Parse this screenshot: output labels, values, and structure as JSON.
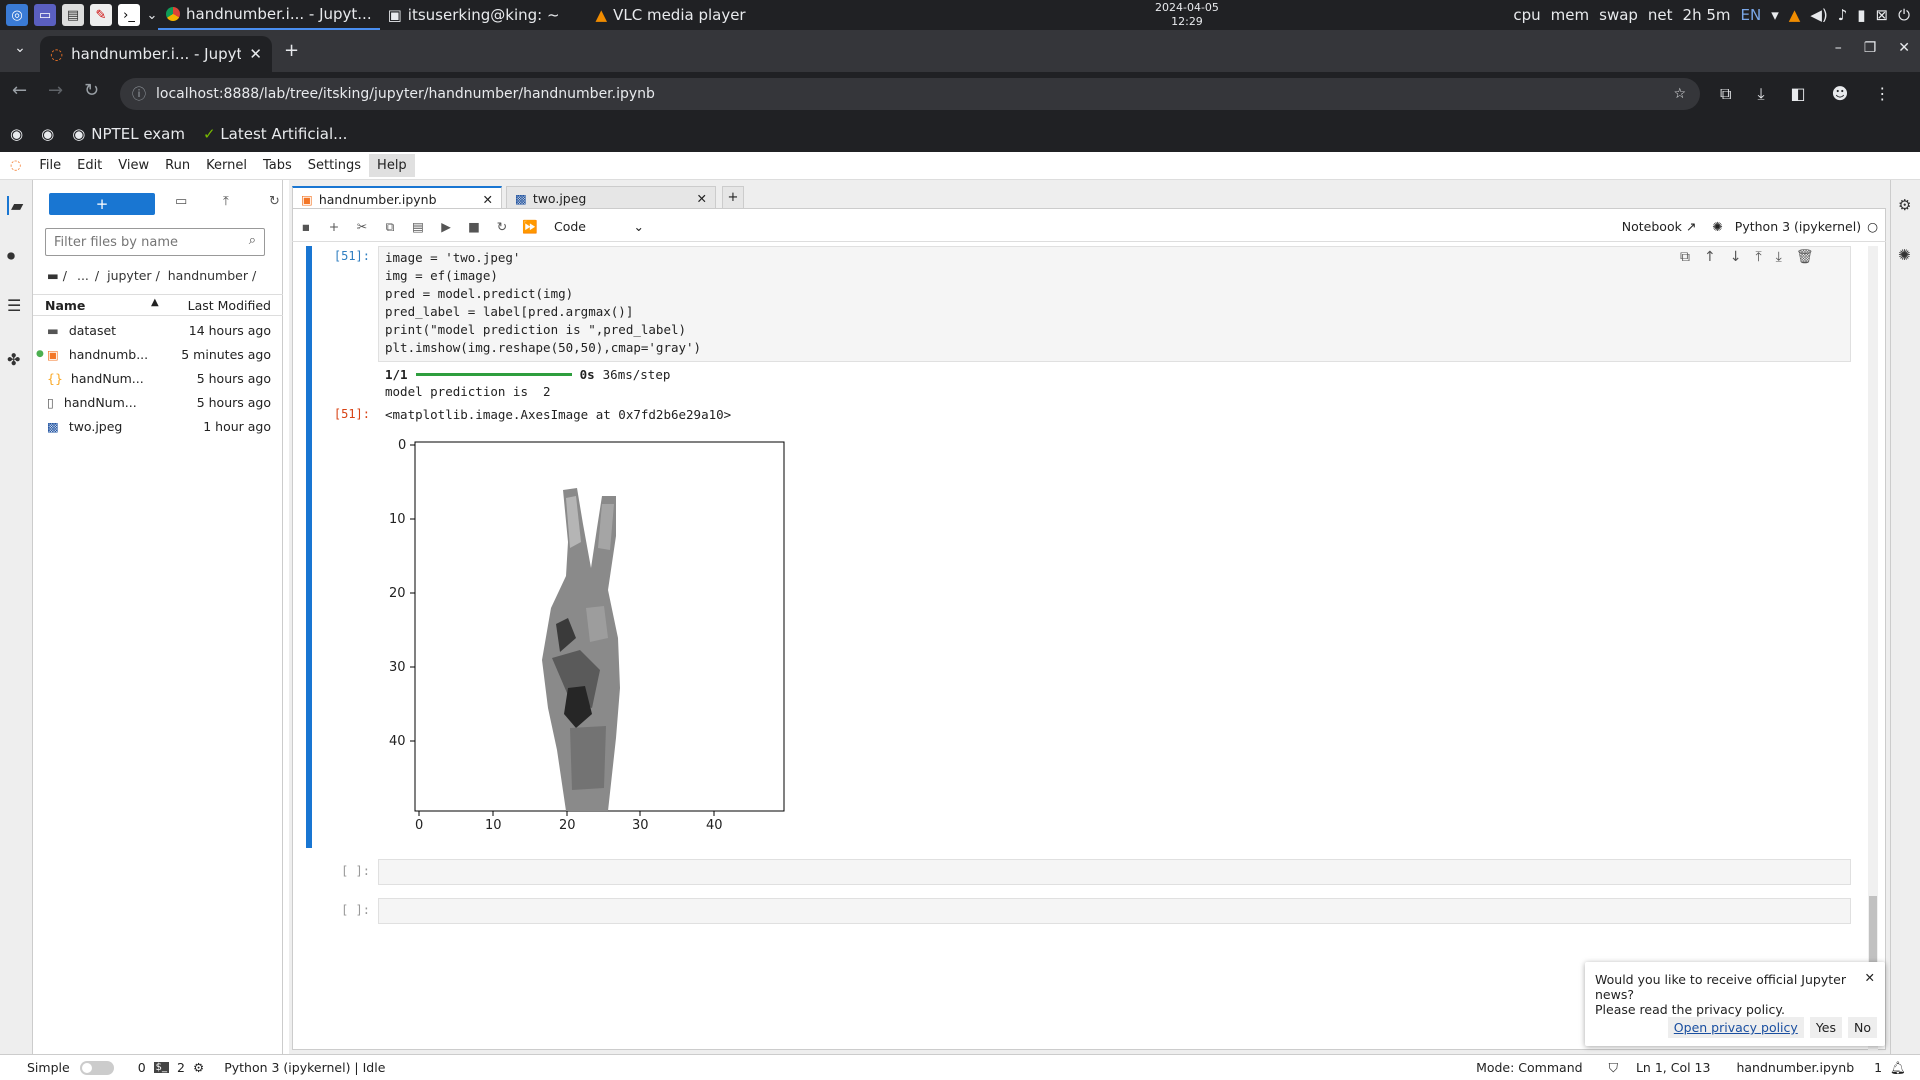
{
  "taskbar": {
    "tasks": [
      {
        "label": "handnumber.i... - Jupyt..."
      },
      {
        "label": "itsuserking@king: ~"
      },
      {
        "label": "VLC media player"
      }
    ],
    "date": "2024-04-05",
    "time": "12:29",
    "indicators": [
      "cpu",
      "mem",
      "swap",
      "net",
      "2h 5m",
      "EN"
    ]
  },
  "browser": {
    "tab_title": "handnumber.i... - Jupyte",
    "url": "localhost:8888/lab/tree/itsking/jupyter/handnumber/handnumber.ipynb",
    "bookmarks": [
      "NPTEL exam",
      "Latest Artificial..."
    ]
  },
  "jupyter": {
    "menu": [
      "File",
      "Edit",
      "View",
      "Run",
      "Kernel",
      "Tabs",
      "Settings",
      "Help"
    ],
    "filebrowser": {
      "new_label": "+",
      "filter_placeholder": "Filter files by name",
      "breadcrumb": [
        "...",
        "jupyter",
        "handnumber"
      ],
      "col_name": "Name",
      "col_modified": "Last Modified",
      "files": [
        {
          "name": "dataset",
          "modified": "14 hours ago",
          "icon": "folder-icon"
        },
        {
          "name": "handnumb...",
          "modified": "5 minutes ago",
          "icon": "notebook-icon"
        },
        {
          "name": "handNum...",
          "modified": "5 hours ago",
          "icon": "json-icon"
        },
        {
          "name": "handNum...",
          "modified": "5 hours ago",
          "icon": "file-icon"
        },
        {
          "name": "two.jpeg",
          "modified": "1 hour ago",
          "icon": "image-icon"
        }
      ]
    },
    "tabs": [
      {
        "label": "handnumber.ipynb"
      },
      {
        "label": "two.jpeg"
      }
    ],
    "toolbar": {
      "cell_type": "Code",
      "notebook_label": "Notebook",
      "kernel_label": "Python 3 (ipykernel)"
    },
    "cell51": {
      "prompt": "[51]:",
      "lines": [
        "image = 'two.jpeg'",
        "img = ef(image)",
        "pred = model.predict(img)",
        "pred_label = label[pred.argmax()]",
        "print(\"model prediction is \",pred_label)",
        "plt.imshow(img.reshape(50,50),cmap='gray')"
      ],
      "progress_step": "1/1",
      "progress_time": "0s",
      "progress_rate": "36ms/step",
      "print_output": "model prediction is  2",
      "out_prompt": "[51]:",
      "result": "<matplotlib.image.AxesImage at 0x7fd2b6e29a10>"
    },
    "plot": {
      "y_ticks": [
        "0",
        "10",
        "20",
        "30",
        "40"
      ],
      "x_ticks": [
        "0",
        "10",
        "20",
        "30",
        "40"
      ]
    },
    "empty_prompt": "[ ]:",
    "statusbar": {
      "simple": "Simple",
      "count0": "0",
      "count1": "2",
      "kernel_status": "Python 3 (ipykernel) | Idle",
      "mode": "Mode: Command",
      "position": "Ln 1, Col 13",
      "filename": "handnumber.ipynb",
      "notifications": "1"
    },
    "toast": {
      "line1": "Would you like to receive official Jupyter news?",
      "line2": "Please read the privacy policy.",
      "link": "Open privacy policy",
      "yes": "Yes",
      "no": "No"
    }
  }
}
